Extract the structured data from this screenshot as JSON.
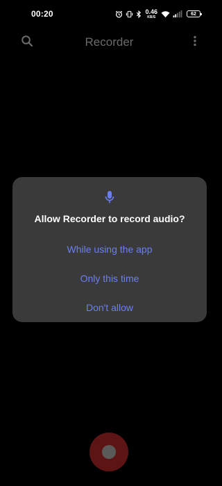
{
  "status_bar": {
    "time": "00:20",
    "net_speed_value": "0.46",
    "net_speed_unit": "KB/S",
    "battery": "62",
    "icons": [
      "alarm-icon",
      "vibrate-icon",
      "bluetooth-icon",
      "wifi-icon",
      "signal-icon",
      "battery-icon"
    ]
  },
  "header": {
    "title": "Recorder",
    "search_icon": "search-icon",
    "more_icon": "more-vert-icon"
  },
  "dialog": {
    "icon": "microphone-icon",
    "title": "Allow Recorder to record audio?",
    "options": [
      {
        "label": "While using the app"
      },
      {
        "label": "Only this time"
      },
      {
        "label": "Don't allow"
      }
    ],
    "accent_color": "#6a80f2",
    "background_color": "#3a3a3a"
  },
  "record_button": {
    "icon": "record-icon",
    "color": "#5c1414"
  }
}
